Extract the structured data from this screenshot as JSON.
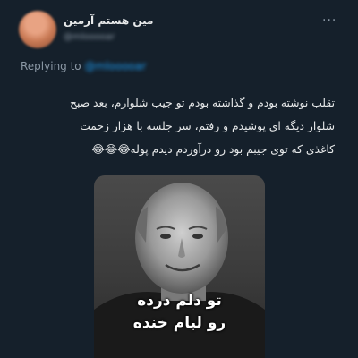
{
  "tweet": {
    "display_name": "مین هستم آرمین",
    "handle": "@mlooooar",
    "replying_label": "Replying to",
    "replying_handle": "@mlooooar",
    "text_lines": [
      "تقلب نوشته بودم و گذاشته بودم تو جیب شلوارم، بعد صبح",
      "شلوار دیگه ای پوشیدم و رفتم، سر جلسه با هزار زحمت",
      "کاغذی که توی جیبم بود رو درآوردم دیدم پوله😂😂😂"
    ]
  },
  "media": {
    "caption_line1": "تو دلم درده",
    "caption_line2": "رو لبام خنده"
  },
  "colors": {
    "background": "#15202b",
    "text": "#e7e9ea",
    "secondary_text": "#8b98a5",
    "link": "#1d9bf0"
  },
  "icons": {
    "more": "more-horizontal-icon"
  }
}
